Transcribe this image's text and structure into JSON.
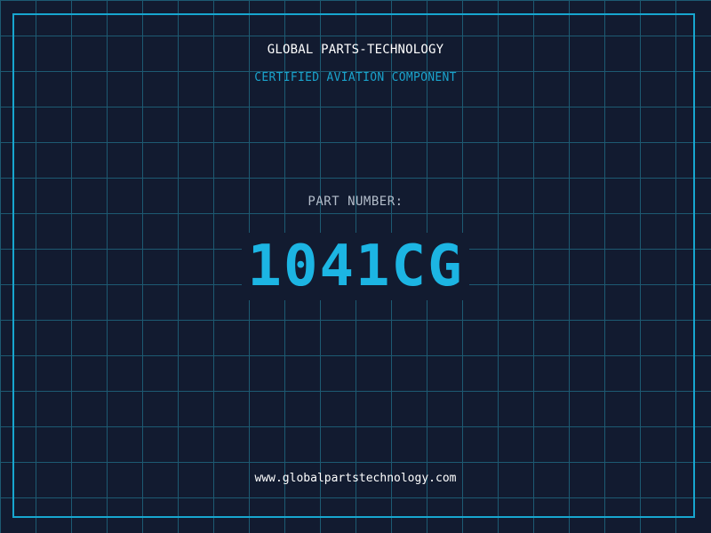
{
  "label": {
    "company": "GLOBAL PARTS-TECHNOLOGY",
    "tagline": "CERTIFIED AVIATION COMPONENT",
    "part_number_label": "PART NUMBER:",
    "part_number": "1041CG",
    "website": "www.globalpartstechnology.com"
  },
  "colors": {
    "background": "#121b30",
    "grid": "#1d5a72",
    "accent": "#1cb5e3",
    "frame": "#17a6cf"
  }
}
